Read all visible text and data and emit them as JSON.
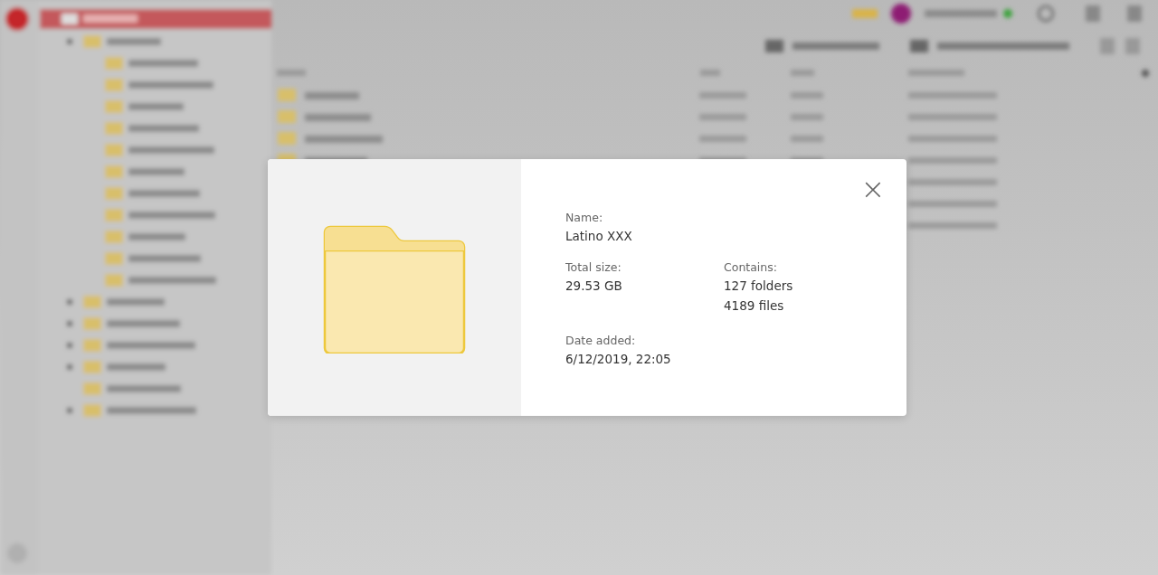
{
  "dialog": {
    "close": "×",
    "fields": [
      {
        "kind": "wide",
        "label": "Name:",
        "values": [
          "Latino XXX"
        ]
      },
      {
        "kind": "half",
        "label": "Total size:",
        "values": [
          "29.53 GB"
        ]
      },
      {
        "kind": "half",
        "label": "Contains:",
        "values": [
          "127 folders",
          "4189 files"
        ]
      },
      {
        "kind": "wide",
        "label": "Date added:",
        "values": [
          "6/12/2019, 22:05"
        ]
      }
    ]
  }
}
